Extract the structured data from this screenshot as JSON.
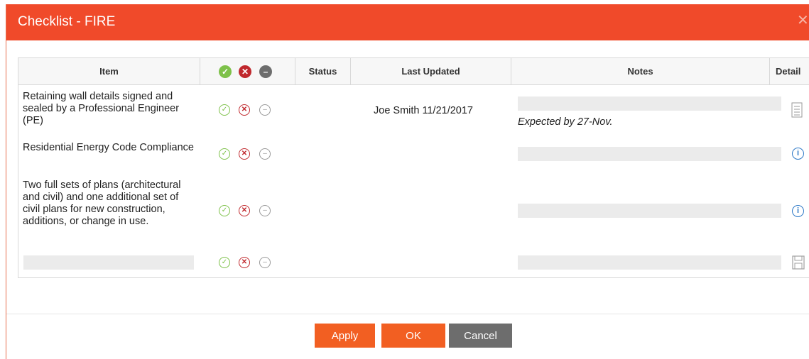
{
  "dialog": {
    "title": "Checklist - FIRE",
    "close_glyph": "✕",
    "accent": "#f04a2a"
  },
  "table": {
    "headers": {
      "item": "Item",
      "status": "Status",
      "last_updated": "Last Updated",
      "notes": "Notes",
      "details": "Detail"
    },
    "header_icons": [
      "check-icon",
      "x-icon",
      "minus-icon"
    ],
    "rows": [
      {
        "item": "Retaining wall details signed and sealed by a Professional Engineer (PE)",
        "last_updated": "Joe Smith 11/21/2017",
        "note_text": "Expected by 27-Nov."
      },
      {
        "item": "Residential Energy Code Compliance"
      },
      {
        "item": "Two full sets of plans (architectural and civil) and one additional set of civil plans for new construction, additions, or change in use."
      }
    ]
  },
  "buttons": {
    "apply": "Apply",
    "ok": "OK",
    "cancel": "Cancel"
  },
  "colors": {
    "approve": "#7ec14a",
    "reject": "#c0282d",
    "na": "#6d6d6d",
    "button": "#f25f22"
  }
}
